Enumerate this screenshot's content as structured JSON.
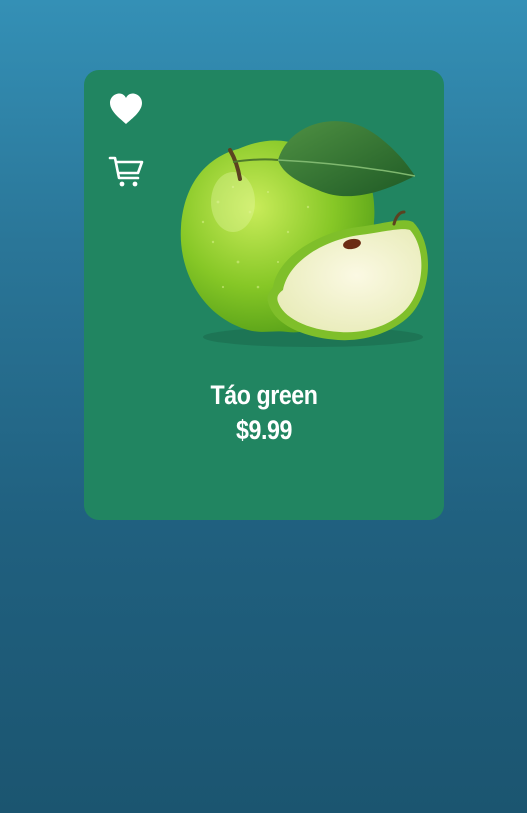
{
  "product": {
    "name": "Táo green",
    "price": "$9.99",
    "image_icon": "green-apple-image"
  },
  "actions": {
    "favorite_icon": "heart-icon",
    "cart_icon": "cart-icon"
  },
  "colors": {
    "background_top": "#3490b6",
    "background_bottom": "#1b5570",
    "card": "#218561",
    "text": "#ffffff"
  }
}
